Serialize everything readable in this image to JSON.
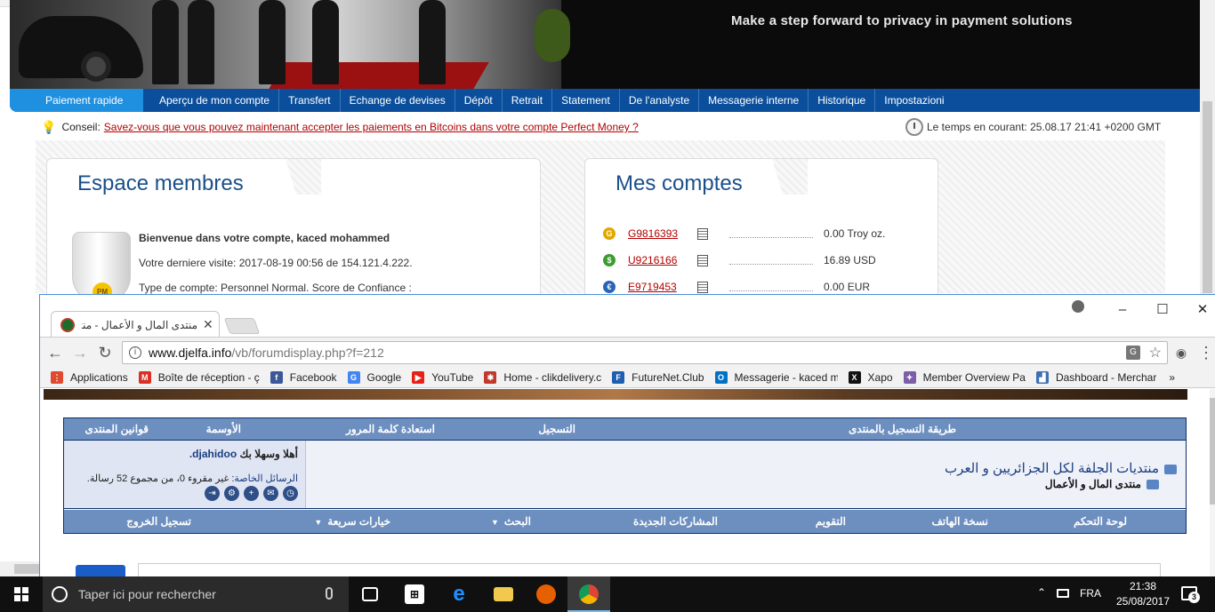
{
  "bg_browser": {
    "banner_tagline": "Make a step forward to privacy in payment solutions",
    "nav": [
      "Paiement rapide",
      "Aperçu de mon compte",
      "Transfert",
      "Echange de devises",
      "Dépôt",
      "Retrait",
      "Statement",
      "De l'analyste",
      "Messagerie interne",
      "Historique",
      "Impostazioni"
    ],
    "tip_label": "Conseil:",
    "tip_link": "Savez-vous que vous pouvez maintenant accepter les paiements en Bitcoins dans votre compte Perfect Money ?",
    "time_text": "Le temps en courant: 25.08.17 21:41 +0200 GMT",
    "membres": {
      "title": "Espace membres",
      "welcome": "Bienvenue dans votre compte, kaced mohammed",
      "last_visit": "Votre derniere visite: 2017-08-19 00:56 de 154.121.4.222.",
      "account_type": "Type de compte: Personnel Normal. Score de Confiance :",
      "avatar_badge": "PM"
    },
    "comptes": {
      "title": "Mes comptes",
      "accounts": [
        {
          "coin": "G",
          "id": "G9816393",
          "balance": "0.00 Troy oz.",
          "color": "#e0a800"
        },
        {
          "coin": "$",
          "id": "U9216166",
          "balance": "16.89 USD",
          "color": "#3a9d2e"
        },
        {
          "coin": "€",
          "id": "E9719453",
          "balance": "0.00 EUR",
          "color": "#2a64b8"
        }
      ]
    }
  },
  "fg_browser": {
    "tab_title": "منتدى المال و الأعمال - منتديات",
    "url_host": "www.djelfa.info",
    "url_path": "/vb/forumdisplay.php?f=212",
    "bookmarks": [
      {
        "label": "Applications",
        "icon": "apps-grid-icon",
        "color": "#e04a2f",
        "glyph": "⋮"
      },
      {
        "label": "Boîte de réception - ç",
        "icon": "gmail-icon",
        "color": "#d93025",
        "glyph": "M"
      },
      {
        "label": "Facebook",
        "icon": "facebook-icon",
        "color": "#3b5998",
        "glyph": "f"
      },
      {
        "label": "Google",
        "icon": "google-icon",
        "color": "#4285f4",
        "glyph": "G"
      },
      {
        "label": "YouTube",
        "icon": "youtube-icon",
        "color": "#e62117",
        "glyph": "▶"
      },
      {
        "label": "Home - clikdelivery.c",
        "icon": "clikdelivery-icon",
        "color": "#c0392b",
        "glyph": "✱"
      },
      {
        "label": "FutureNet.Club",
        "icon": "futurenet-icon",
        "color": "#1f5fb0",
        "glyph": "F"
      },
      {
        "label": "Messagerie - kaced m",
        "icon": "outlook-icon",
        "color": "#0072c6",
        "glyph": "O"
      },
      {
        "label": "Xapo",
        "icon": "xapo-icon",
        "color": "#111111",
        "glyph": "X"
      },
      {
        "label": "Member Overview Pa",
        "icon": "member-overview-icon",
        "color": "#7b5ea7",
        "glyph": "✦"
      },
      {
        "label": "Dashboard - Merchar",
        "icon": "dashboard-icon",
        "color": "#3d6fb5",
        "glyph": "▟"
      }
    ],
    "forum": {
      "top_nav": [
        "طريقة التسجيل بالمنتدى",
        "التسجيل",
        "استعادة كلمة المرور",
        "الأوسمة",
        "قوانين المنتدى"
      ],
      "welcome_prefix": "أهلا وسهلا بك",
      "username": "djahidoo.",
      "pm_label": "الرسائل الخاصة",
      "pm_text": ": غير مقروء 0، من مجموع 52 رسالة.",
      "breadcrumb_1": "منتديات الجلفة لكل الجزائريين و العرب",
      "breadcrumb_2": "منتدى المال و الأعمال",
      "bottom_nav": [
        "لوحة التحكم",
        "نسخة الهاتف",
        "التقويم",
        "المشاركات الجديدة",
        "البحث",
        "خيارات سريعة",
        "تسجيل الخروج"
      ],
      "user_icons": [
        "logout-icon",
        "settings-icon",
        "add-user-icon",
        "chat-icon",
        "clock-icon"
      ]
    }
  },
  "taskbar": {
    "search_placeholder": "Taper ici pour rechercher",
    "lang": "FRA",
    "time": "21:38",
    "date": "25/08/2017",
    "notif_count": "3"
  }
}
